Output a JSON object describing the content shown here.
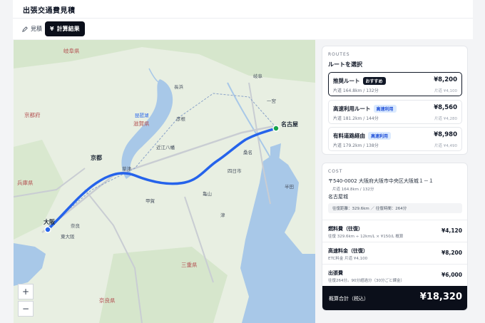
{
  "header": {
    "title": "出張交通費見積"
  },
  "tabs": [
    {
      "label": "見積",
      "icon": "pencil-icon"
    },
    {
      "label": "計算結果",
      "icon": "yen-icon"
    }
  ],
  "map": {
    "labels": {
      "kyoto": "京都",
      "osaka": "大阪",
      "nagoya": "名古屋",
      "nara": "奈良",
      "higashiosaka": "東大阪",
      "kusatsu": "草津",
      "yokkaichi": "四日市",
      "gifu": "岐阜",
      "ichinomiya": "一宮",
      "kuwana": "桑名",
      "hikone": "彦根",
      "omihachiman": "近江八幡",
      "nagahama": "長浜",
      "kameyama": "亀山",
      "kouka": "甲賀",
      "handa": "半田",
      "tsu": "津",
      "biwako": "琵琶湖",
      "shigapref": "滋賀県",
      "kyotopref": "京都府",
      "miepref": "三重県",
      "narapref": "奈良県",
      "hyogopref": "兵庫県",
      "gifupref": "岐阜県"
    },
    "zoom_in": "+",
    "zoom_out": "−"
  },
  "routes": {
    "section_label": "ROUTES",
    "title": "ルートを選択",
    "items": [
      {
        "name": "推奨ルート",
        "badge": "おすすめ",
        "sub": "片道 164.8km / 132分",
        "price": "¥8,200",
        "oneway": "片道 ¥4,100"
      },
      {
        "name": "高速利用ルート",
        "badge": "高速利用",
        "sub": "片道 181.2km / 144分",
        "price": "¥8,560",
        "oneway": "片道 ¥4,280"
      },
      {
        "name": "有料道路経由",
        "badge": "高速利用",
        "sub": "片道 179.2km / 138分",
        "price": "¥8,980",
        "oneway": "片道 ¥4,490"
      }
    ]
  },
  "cost": {
    "section_label": "COST",
    "origin": "〒540-0002 大阪府大阪市中央区大阪城１－１",
    "origin_sub": "片道 164.8km / 132分",
    "destination": "名古屋城",
    "summary": "往復距離：329.6km ／ 往復時間：264分",
    "items": [
      {
        "name": "燃料費（往復）",
        "detail": "往復 329.6km ÷ 12km/L × ¥150/L 概算",
        "value": "¥4,120"
      },
      {
        "name": "高速料金（往復）",
        "detail": "ETC料金 片道 ¥4,100",
        "value": "¥8,200"
      },
      {
        "name": "出張費",
        "detail": "往復264分。90分超過分（30分ごと課金）",
        "value": "¥6,000"
      }
    ],
    "total_label": "概算合計（税込）",
    "total_value": "¥18,320"
  },
  "colors": {
    "accent": "#0b0f1a",
    "route": "#2563eb",
    "water": "#a8c8e8",
    "land": "#e8efe2"
  }
}
